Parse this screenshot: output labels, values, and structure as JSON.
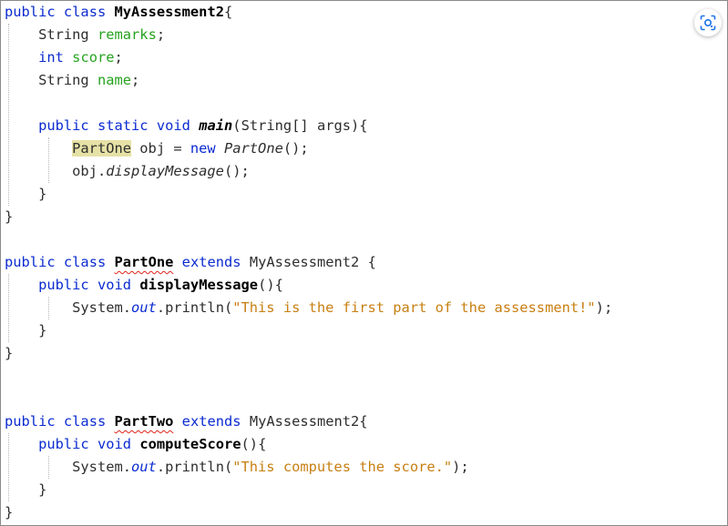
{
  "colors": {
    "keyword": "#0b2bd1",
    "field": "#26a31f",
    "string": "#c87f12",
    "highlight": "#e6e1a5",
    "error": "#e2231a"
  },
  "code": {
    "s": " ",
    "i1": "    ",
    "i2": "        ",
    "kw_public": "public",
    "kw_class": "class",
    "kw_int": "int",
    "kw_static": "static",
    "kw_void": "void",
    "kw_new": "new",
    "kw_extends": "extends",
    "ty_string": "String",
    "ty_string_arr": "String[]",
    "class_assessment": "MyAssessment2",
    "class_partone": "PartOne",
    "class_parttwo": "PartTwo",
    "brace_open": "{",
    "brace_close": "}",
    "field_remarks": "remarks",
    "field_score": "score",
    "field_name": "name",
    "semi": ";",
    "meth_main": "main",
    "args": "(String[] args){",
    "obj_eq": " obj = ",
    "ctor_call": "PartOne",
    "paren_semi": "();",
    "obj_dot": "obj.",
    "meth_display": "displayMessage",
    "meth_compute": "computeScore",
    "paren_brace": "(){",
    "system_dot": "System.",
    "out": "out",
    "println_open": ".println(",
    "str_first": "\"This is the first part of the assessment!\"",
    "str_compute": "\"This computes the score.\"",
    "close_call": ");"
  },
  "toolbar": {
    "lens_icon": "lens-icon"
  }
}
